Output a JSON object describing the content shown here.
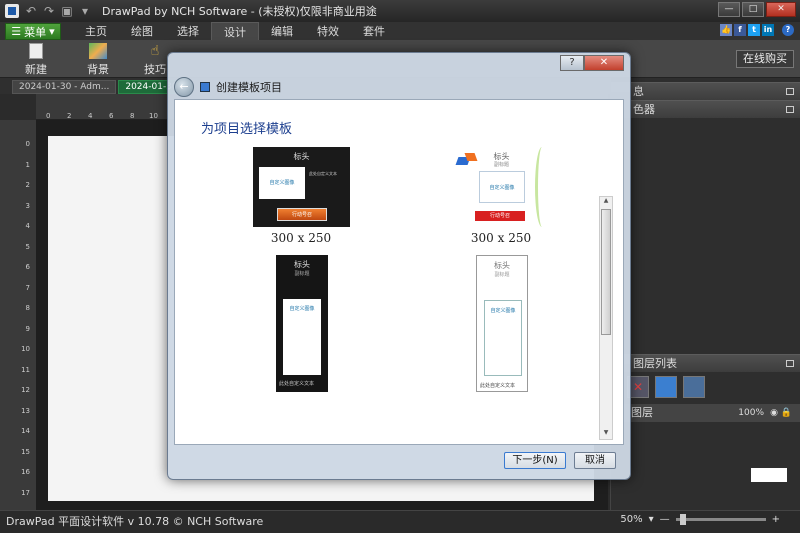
{
  "window": {
    "title": "DrawPad by NCH Software - (未授权)仅限非商业用途"
  },
  "menubar": {
    "menu_label": "菜单",
    "tabs": [
      "主页",
      "绘图",
      "选择",
      "设计",
      "编辑",
      "特效",
      "套件"
    ],
    "active_tab": "设计"
  },
  "toolbar": {
    "new_label": "新建",
    "background_label": "背景",
    "third_label": "技巧"
  },
  "buy_label": "在线购买",
  "doc_tabs": [
    {
      "label": "2024-01-30 - Adm..."
    },
    {
      "label": "2024-01-30 - "
    }
  ],
  "ruler_numbers": [
    "0",
    "2",
    "4",
    "6",
    "8",
    "10"
  ],
  "ruler_v_numbers": [
    "0",
    "1",
    "2",
    "3",
    "4",
    "5",
    "6",
    "7",
    "8",
    "9",
    "10",
    "11",
    "12",
    "13",
    "14",
    "15",
    "16",
    "17"
  ],
  "right_panel": {
    "panel1": "息",
    "panel2": "色器",
    "layers_title": "图层列表",
    "layer_name": "图层",
    "opacity": "100%"
  },
  "status": {
    "text": "DrawPad 平面设计软件 v 10.78 © NCH Software",
    "zoom": "50%"
  },
  "dialog": {
    "title": "创建模板项目",
    "heading": "为项目选择模板",
    "templates": [
      {
        "title": "标头",
        "image_label": "自定义图像",
        "button": "行动号召",
        "text": "此处自定义文本",
        "caption": "300 x 250"
      },
      {
        "title": "标头",
        "subtitle": "副标题",
        "image_label": "自定义图像",
        "button": "行动号召",
        "caption": "300 x 250"
      },
      {
        "title": "标头",
        "subtitle": "副标题",
        "image_label": "自定义图像",
        "text": "此处自定义文本"
      },
      {
        "title": "标头",
        "subtitle": "副标题",
        "image_label": "自定义图像",
        "text": "此处自定义文本"
      }
    ],
    "next_label": "下一步(N)",
    "cancel_label": "取消"
  }
}
